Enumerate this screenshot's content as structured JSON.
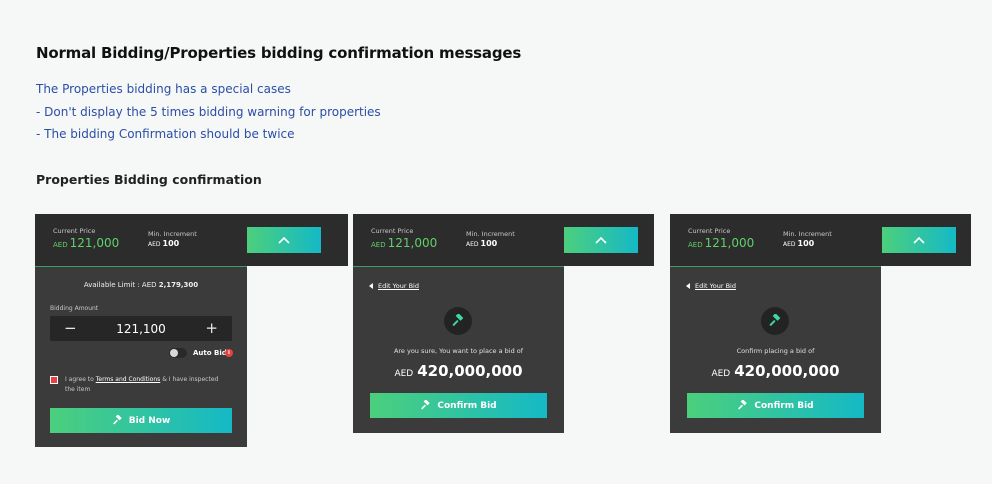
{
  "page": {
    "title": "Normal Bidding/Properties bidding confirmation messages",
    "notes": [
      "The Properties bidding has a special cases",
      "- Don't display the 5 times bidding warning for properties",
      "- The bidding Confirmation should be twice"
    ],
    "section_title": "Properties Bidding confirmation"
  },
  "header_bar": {
    "current_price_label": "Current Price",
    "currency": "AED",
    "current_price": "121,000",
    "min_increment_label": "Min. Increment",
    "min_increment": "100"
  },
  "card1": {
    "available_limit_label": "Available Limit : AED",
    "available_limit": "2,179,300",
    "bidding_amount_label": "Bidding Amount",
    "bid_amount": "121,100",
    "minus": "−",
    "plus": "+",
    "auto_bid_label": "Auto Bid",
    "auto_bid_on": false,
    "info_icon_text": "i",
    "terms_prefix": "I agree to",
    "terms_link": "Terms and Conditions",
    "terms_suffix": "& I have inspected the item",
    "agree_checked": true,
    "bid_button": "Bid Now"
  },
  "card2": {
    "edit_link": "Edit Your Bid",
    "message": "Are you sure, You want to place a bid of",
    "currency": "AED",
    "amount": "420,000,000",
    "confirm_button": "Confirm Bid"
  },
  "card3": {
    "edit_link": "Edit Your Bid",
    "message": "Confirm placing a bid of",
    "currency": "AED",
    "amount": "420,000,000",
    "confirm_button": "Confirm Bid"
  },
  "colors": {
    "accent_green": "#4ccf7c",
    "accent_teal": "#15b9c6",
    "price_green": "#5fd06a",
    "warning_red": "#e94040",
    "note_blue": "#2b4ea6",
    "panel_dark": "#3b3b3b",
    "bar_dark": "#2c2c2c"
  }
}
